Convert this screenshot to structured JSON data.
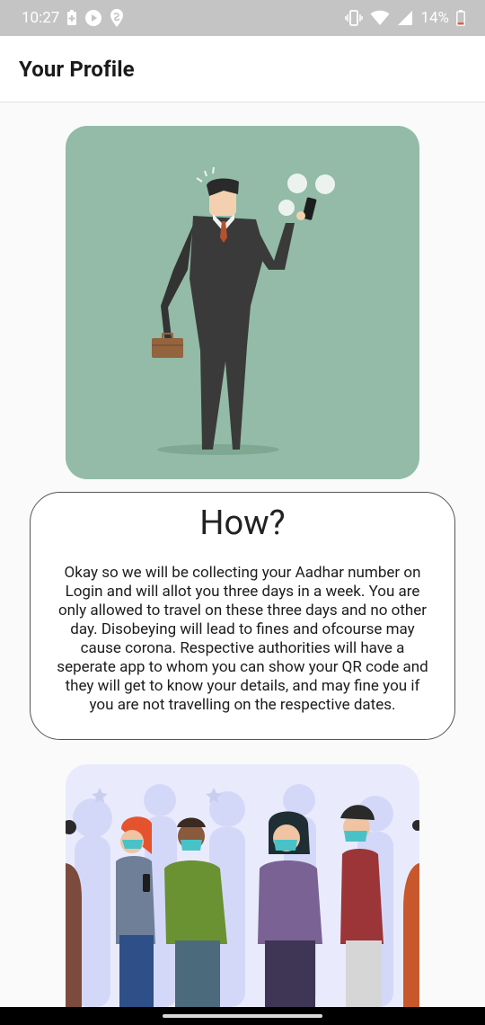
{
  "status_bar": {
    "time": "10:27",
    "battery_percent": "14%",
    "icons_left": [
      "battery-saver-icon",
      "play-icon",
      "swiggy-icon"
    ],
    "icons_right": [
      "vibrate-icon",
      "wifi-icon",
      "signal-icon",
      "battery-low-icon"
    ]
  },
  "app_bar": {
    "title": "Your Profile"
  },
  "illustrations": {
    "top": "businessman-with-phone-illustration",
    "bottom": "people-wearing-masks-illustration"
  },
  "how_card": {
    "title": "How?",
    "body": "Okay so we will be collecting your Aadhar number on Login and will allot you three days in a week. You are only allowed to travel on these three days and no other day. Disobeying will lead to fines and ofcourse may cause corona. Respective authorities will have a seperate app to whom you can show your QR code and they will get to know your details, and may fine you if you are not travelling on the respective dates."
  },
  "colors": {
    "status_bar": "#c4c4c4",
    "top_card_bg": "#93bba7",
    "bottom_card_bg": "#e9ebfd",
    "battery_low": "#e5532e"
  }
}
